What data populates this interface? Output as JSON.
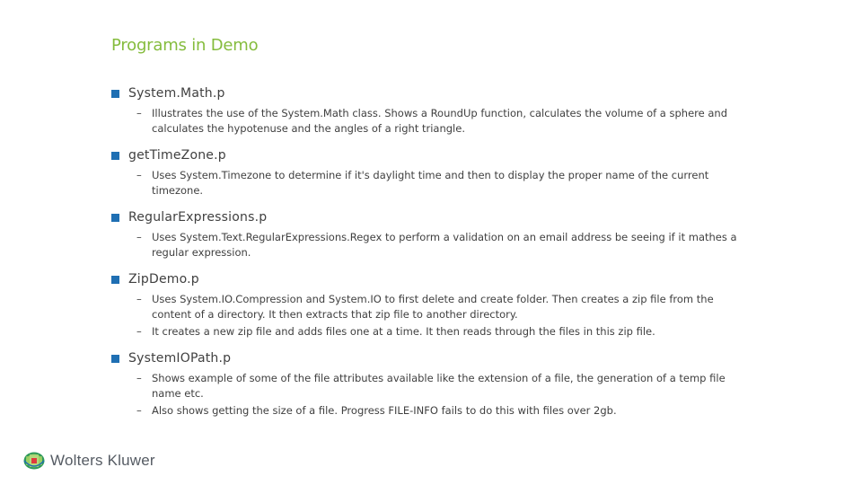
{
  "slide": {
    "title": "Programs in Demo"
  },
  "items": [
    {
      "title": "System.Math.p",
      "subitems": [
        "Illustrates the use of the System.Math class. Shows a RoundUp function, calculates the volume of a sphere and calculates the hypotenuse and the angles of a right triangle."
      ]
    },
    {
      "title": "getTimeZone.p",
      "subitems": [
        "Uses System.Timezone to determine if it's daylight time and then to display the proper name of the current timezone."
      ]
    },
    {
      "title": "RegularExpressions.p",
      "subitems": [
        "Uses System.Text.RegularExpressions.Regex to perform a validation on an email address be seeing if it mathes a regular expression."
      ]
    },
    {
      "title": "ZipDemo.p",
      "subitems": [
        "Uses System.IO.Compression and System.IO to first delete and create folder. Then creates a zip file from the content of a directory. It then extracts that zip file to another directory.",
        "It creates a new zip file and adds files one at a time. It then reads through the files in this zip file."
      ]
    },
    {
      "title": "SystemIOPath.p",
      "subitems": [
        "Shows example of some of the file attributes available like the extension of a file, the generation of a temp file name etc.",
        "Also shows getting the size of a file. Progress FILE-INFO fails to do this with files over 2gb."
      ]
    }
  ],
  "bullets": {
    "dash": "–"
  },
  "footer": {
    "logo_text": "Wolters Kluwer",
    "logo_icon": "wolters-kluwer-globe-icon"
  },
  "colors": {
    "title": "#85bc3d",
    "bullet": "#1f6fb3",
    "text": "#404040"
  }
}
